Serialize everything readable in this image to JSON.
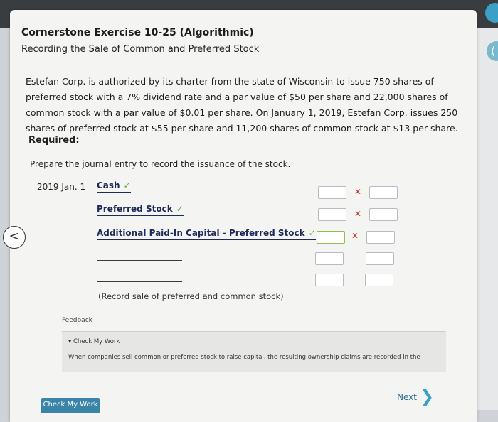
{
  "header": {
    "title": "Cornerstone Exercise 10-25 (Algorithmic)",
    "subtitle": "Recording the Sale of Common and Preferred Stock"
  },
  "problem": {
    "text": "Estefan Corp. is authorized by its charter from the state of Wisconsin to issue 750 shares of preferred stock with a 7% dividend rate and a par value of $50 per share and 22,000 shares of common stock with a par value of $0.01 per share. On January 1, 2019, Estefan Corp. issues 250 shares of preferred stock at $55 per share and 11,200 shares of common stock at $13 per share."
  },
  "required": {
    "label": "Required:",
    "instruction": "Prepare the journal entry to record the issuance of the stock."
  },
  "journal": {
    "date": "2019 Jan. 1",
    "rows": [
      {
        "account": "Cash",
        "correct": true,
        "debit_status": "x"
      },
      {
        "account": "Preferred Stock",
        "correct": true,
        "debit_status": "x"
      },
      {
        "account": "Additional Paid-In Capital - Preferred Stock",
        "correct": true,
        "debit_status": "x"
      },
      {
        "account": "",
        "correct": false,
        "debit_status": ""
      },
      {
        "account": "",
        "correct": false,
        "debit_status": ""
      }
    ],
    "note": "(Record sale of preferred and common stock)",
    "check_glyph": "✓",
    "x_glyph": "✕"
  },
  "feedback": {
    "label": "Feedback",
    "toggle": "▾ Check My Work",
    "text": "When companies sell common or preferred stock to raise capital, the resulting ownership claims are recorded in the"
  },
  "footer": {
    "check_button": "Check My Work",
    "next_label": "Next",
    "next_chevron": "❯"
  },
  "nav": {
    "back_glyph": "<"
  },
  "colors": {
    "accent": "#3a84a8",
    "correct": "#6aa84f",
    "wrong": "#c0392b"
  }
}
